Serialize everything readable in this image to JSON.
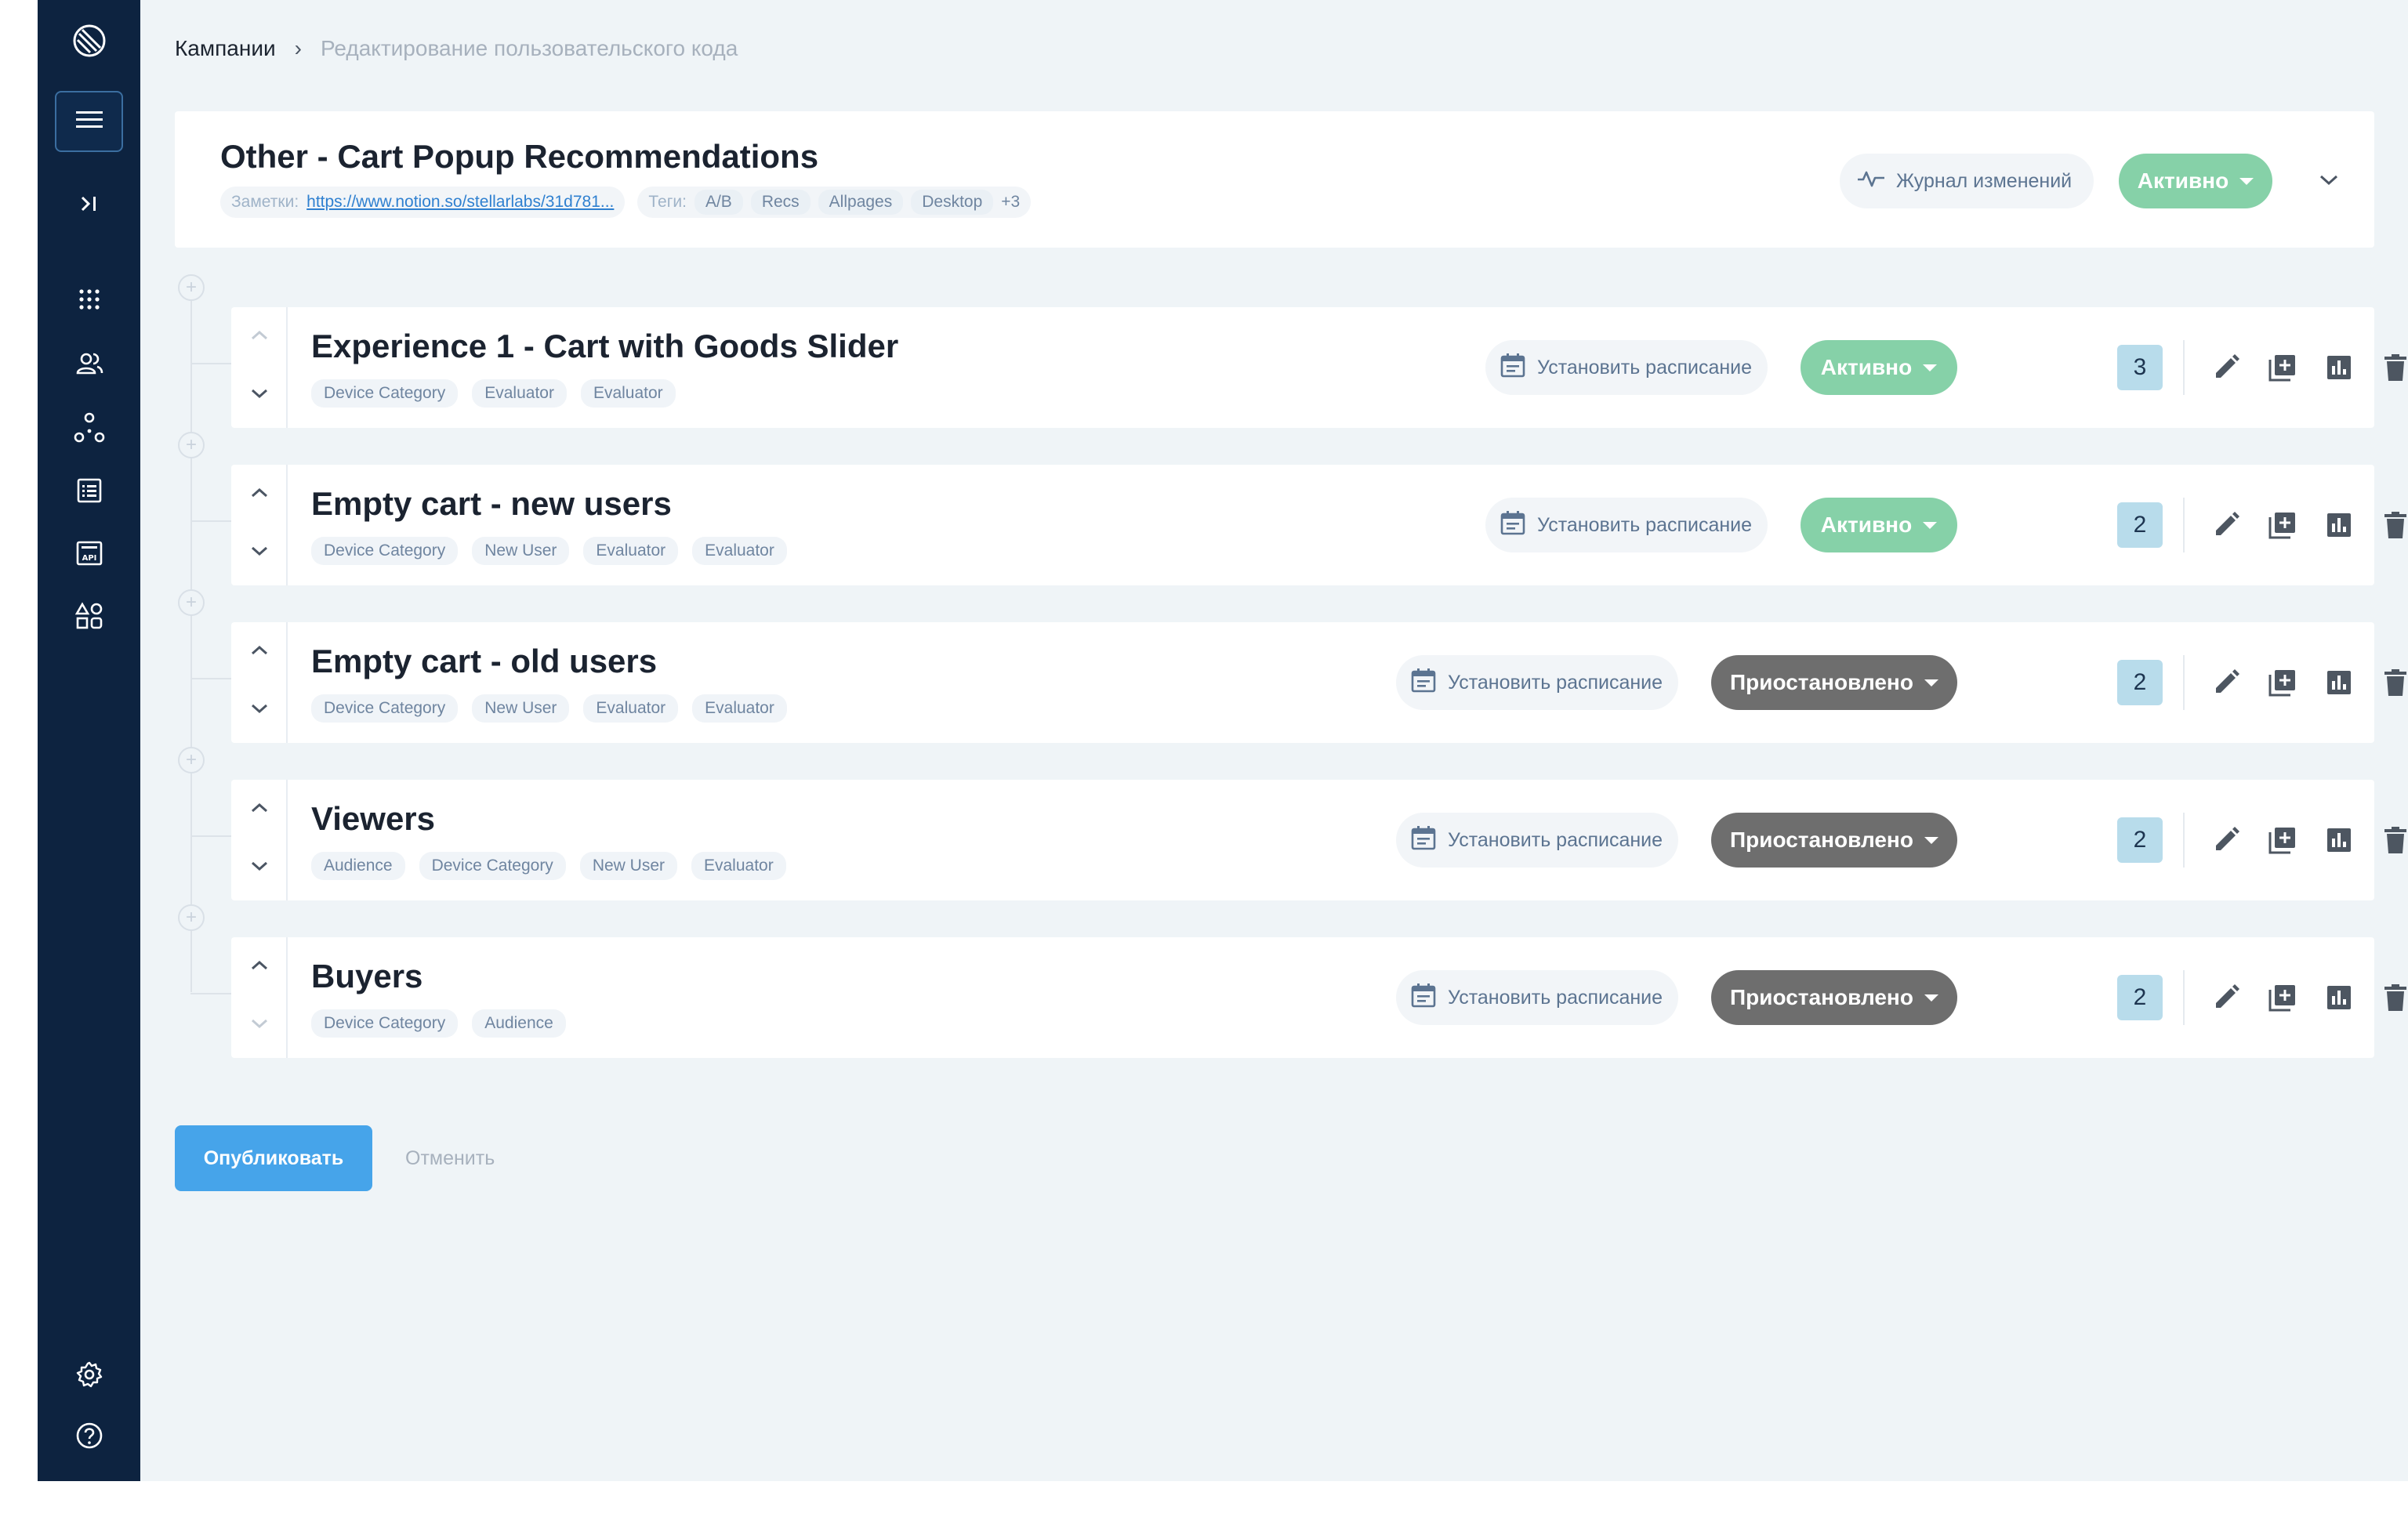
{
  "breadcrumb": {
    "root": "Кампании",
    "current": "Редактирование пользовательского кода"
  },
  "campaign": {
    "title": "Other - Cart Popup Recommendations",
    "notes_label": "Заметки:",
    "notes_link": "https://www.notion.so/stellarlabs/31d781...",
    "tags_label": "Теги:",
    "tags": [
      "A/B",
      "Recs",
      "Allpages",
      "Desktop"
    ],
    "tags_more": "+3",
    "journal_label": "Журнал изменений",
    "status": "Активно"
  },
  "experiences": [
    {
      "title": "Experience 1 - Cart with Goods Slider",
      "tags": [
        "Device Category",
        "Evaluator",
        "Evaluator"
      ],
      "schedule_label": "Установить расписание",
      "status": "Активно",
      "count": "3"
    },
    {
      "title": "Empty cart - new users",
      "tags": [
        "Device Category",
        "New User",
        "Evaluator",
        "Evaluator"
      ],
      "schedule_label": "Установить расписание",
      "status": "Активно",
      "count": "2"
    },
    {
      "title": "Empty cart - old users",
      "tags": [
        "Device Category",
        "New User",
        "Evaluator",
        "Evaluator"
      ],
      "schedule_label": "Установить расписание",
      "status": "Приостановлено",
      "count": "2"
    },
    {
      "title": "Viewers",
      "tags": [
        "Audience",
        "Device Category",
        "New User",
        "Evaluator"
      ],
      "schedule_label": "Установить расписание",
      "status": "Приостановлено",
      "count": "2"
    },
    {
      "title": "Buyers",
      "tags": [
        "Device Category",
        "Audience"
      ],
      "schedule_label": "Установить расписание",
      "status": "Приостановлено",
      "count": "2"
    }
  ],
  "actions": {
    "publish": "Опубликовать",
    "cancel": "Отменить"
  },
  "colors": {
    "sidebar": "#0d2340",
    "active": "#86d1a8",
    "paused": "#6e6e6e",
    "primary": "#46a4ea",
    "count_badge": "#b8dceb"
  },
  "icons": {
    "sidebar": [
      "logo-icon",
      "menu-icon",
      "collapse-icon",
      "apps-grid-icon",
      "users-icon",
      "segments-icon",
      "list-icon",
      "api-icon",
      "shapes-icon",
      "settings-icon",
      "help-icon"
    ],
    "row_actions": [
      "pencil-icon",
      "duplicate-icon",
      "bar-chart-icon",
      "trash-icon",
      "chevron-down-icon"
    ]
  }
}
